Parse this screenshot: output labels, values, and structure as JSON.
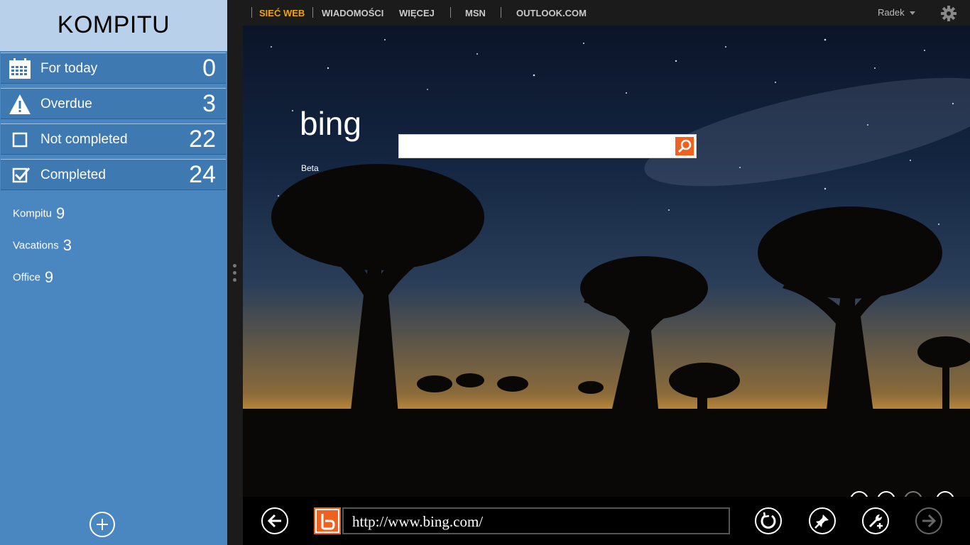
{
  "sidebar": {
    "title": "KOMPITU",
    "filters": [
      {
        "label": "For today",
        "count": "0",
        "icon": "calendar-icon"
      },
      {
        "label": "Overdue",
        "count": "3",
        "icon": "warning-icon"
      },
      {
        "label": "Not completed",
        "count": "22",
        "icon": "checkbox-empty-icon"
      },
      {
        "label": "Completed",
        "count": "24",
        "icon": "checkbox-checked-icon"
      }
    ],
    "lists": [
      {
        "name": "Kompitu",
        "count": "9"
      },
      {
        "name": "Vacations",
        "count": "3"
      },
      {
        "name": "Office",
        "count": "9"
      }
    ],
    "add_icon": "plus-circle-icon"
  },
  "browser": {
    "nav": [
      {
        "label": "SIEĆ WEB",
        "active": true
      },
      {
        "label": "WIADOMOŚCI",
        "active": false
      },
      {
        "label": "WIĘCEJ",
        "active": false
      },
      {
        "label": "MSN",
        "active": false
      },
      {
        "label": "OUTLOOK.COM",
        "active": false
      }
    ],
    "user": "Radek",
    "settings_icon": "gear-icon",
    "bing": {
      "logo_text": "bing",
      "beta_label": "Beta",
      "search_value": "",
      "search_icon": "search-icon"
    },
    "appbar": {
      "back_icon": "back-arrow-icon",
      "site_icon": "bing-favicon-icon",
      "address": "http://www.bing.com/",
      "refresh_icon": "refresh-icon",
      "pin_icon": "pin-icon",
      "tools_icon": "wrench-icon",
      "forward_icon": "forward-arrow-icon"
    }
  },
  "colors": {
    "sidebar_bg": "#4a86c0",
    "sidebar_header": "#b9d0ea",
    "filter_row": "#3f79b2",
    "nav_active": "#f0a30a",
    "bing_orange": "#f0601f"
  }
}
